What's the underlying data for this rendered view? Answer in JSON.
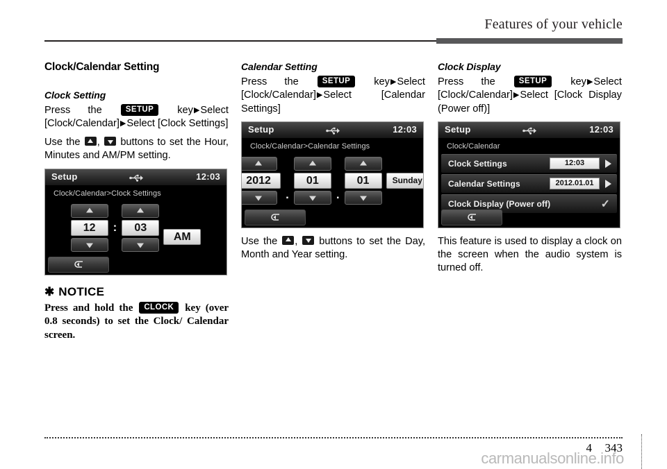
{
  "header": {
    "title": "Features of your vehicle"
  },
  "col1": {
    "section_title": "Clock/Calendar Setting",
    "sub_title": "Clock Setting",
    "press_pre": "Press",
    "press_the": "the",
    "setup_key": "SETUP",
    "key_word": "key",
    "select1": "Select",
    "bracket1": "[Clock/Calendar]",
    "select2": "Select",
    "bracket2": "[Clock",
    "bracket2_end": "Settings]",
    "use_pre": "Use the",
    "use_post": "buttons to set the Hour, Minutes and AM/PM setting.",
    "device": {
      "topbar_title": "Setup",
      "topbar_time": "12:03",
      "breadcrumb": "Clock/Calendar>Clock Settings",
      "hour": "12",
      "colon": ":",
      "minute": "03",
      "ampm": "AM"
    },
    "notice": {
      "star": "✱",
      "word": "NOTICE",
      "text_pre": "Press and hold the",
      "clock_key": "CLOCK",
      "text_post": "key (over 0.8 seconds) to set the Clock/ Calendar screen."
    }
  },
  "col2": {
    "sub_title": "Calendar Setting",
    "press_pre": "Press",
    "press_the": "the",
    "setup_key": "SETUP",
    "key_word": "key",
    "select1": "Select",
    "bracket1": "[Clock/Calendar]",
    "select2": "Select",
    "bracket2": "[Calendar",
    "bracket2_end": "Settings]",
    "device": {
      "topbar_title": "Setup",
      "topbar_time": "12:03",
      "breadcrumb": "Clock/Calendar>Calendar Settings",
      "year": "2012",
      "dot1": ".",
      "month": "01",
      "dot2": ".",
      "day": "01",
      "weekday": "Sunday"
    },
    "use_pre": "Use the",
    "use_post": "buttons to set the Day, Month and Year setting."
  },
  "col3": {
    "sub_title": "Clock Display",
    "press_pre": "Press",
    "press_the": "the",
    "setup_key": "SETUP",
    "key_word": "key",
    "select1": "Select",
    "bracket1": "[Clock/Calendar]",
    "select2": "Select",
    "bracket2": "[Clock",
    "bracket2_end": "Display (Power off)]",
    "device": {
      "topbar_title": "Setup",
      "topbar_time": "12:03",
      "breadcrumb": "Clock/Calendar",
      "rows": [
        {
          "label": "Clock Settings",
          "value": "12:03",
          "control": "chevron"
        },
        {
          "label": "Calendar Settings",
          "value": "2012.01.01",
          "control": "chevron"
        },
        {
          "label": "Clock Display (Power off)",
          "value": "",
          "control": "check"
        }
      ],
      "check_glyph": "✓"
    },
    "description": "This feature is used to display a clock on the screen when the audio system is turned off."
  },
  "footer": {
    "chapter": "4",
    "page": "343",
    "watermark": "carmanualsonline.info"
  }
}
